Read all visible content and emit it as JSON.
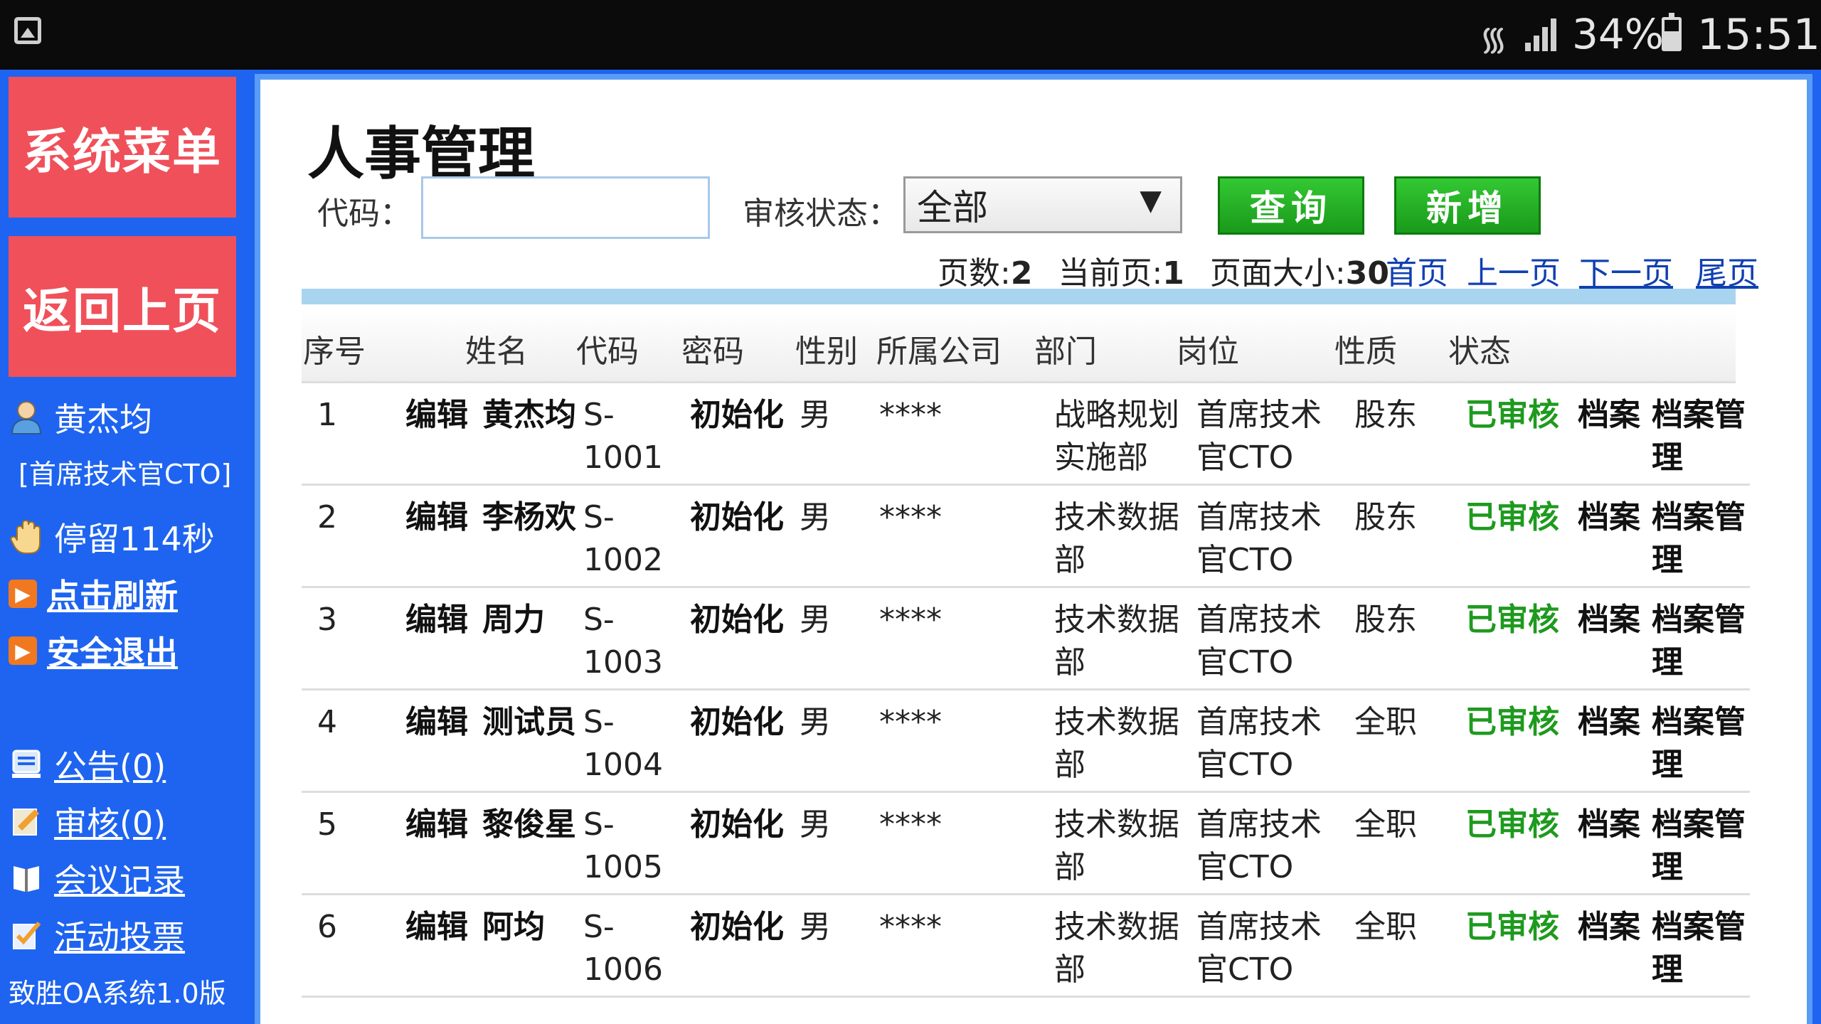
{
  "status_bar": {
    "battery": "34%",
    "time": "15:51"
  },
  "sidebar": {
    "menu_button": "系统菜单",
    "back_button": "返回上页",
    "user_name": "黄杰均",
    "user_role": "[首席技术官CTO]",
    "stay_time": "停留114秒",
    "refresh": "点击刷新",
    "logout": "安全退出",
    "notice": "公告(0)",
    "audit": "审核(0)",
    "meeting": "会议记录",
    "vote": "活动投票",
    "footer": "致胜OA系统1.0版"
  },
  "main": {
    "title": "人事管理",
    "code_label": "代码：",
    "code_value": "",
    "status_label": "审核状态：",
    "status_selected": "全部",
    "query_button": "查询",
    "add_button": "新增",
    "pager": {
      "pages_label": "页数:",
      "pages": "2",
      "current_label": "当前页:",
      "current": "1",
      "size_label": "页面大小:",
      "size": "30",
      "first": "首页",
      "prev": "上一页",
      "next": "下一页",
      "last": "尾页"
    },
    "columns": [
      "序号",
      "姓名",
      "代码",
      "密码",
      "性别",
      "所属公司",
      "部门",
      "岗位",
      "性质",
      "状态"
    ],
    "rows": [
      {
        "no": "1",
        "edit": "编辑",
        "name": "黄杰均",
        "code1": "S-",
        "code2": "1001",
        "pwd": "初始化",
        "gender": "男",
        "company": "****",
        "dept1": "战略规划",
        "dept2": "实施部",
        "post1": "首席技术",
        "post2": "官CTO",
        "nature": "股东",
        "status": "已审核",
        "archive": "档案",
        "archive_mgmt1": "档案管",
        "archive_mgmt2": "理"
      },
      {
        "no": "2",
        "edit": "编辑",
        "name": "李杨欢",
        "code1": "S-",
        "code2": "1002",
        "pwd": "初始化",
        "gender": "男",
        "company": "****",
        "dept1": "技术数据",
        "dept2": "部",
        "post1": "首席技术",
        "post2": "官CTO",
        "nature": "股东",
        "status": "已审核",
        "archive": "档案",
        "archive_mgmt1": "档案管",
        "archive_mgmt2": "理"
      },
      {
        "no": "3",
        "edit": "编辑",
        "name": "周力",
        "code1": "S-",
        "code2": "1003",
        "pwd": "初始化",
        "gender": "男",
        "company": "****",
        "dept1": "技术数据",
        "dept2": "部",
        "post1": "首席技术",
        "post2": "官CTO",
        "nature": "股东",
        "status": "已审核",
        "archive": "档案",
        "archive_mgmt1": "档案管",
        "archive_mgmt2": "理"
      },
      {
        "no": "4",
        "edit": "编辑",
        "name": "测试员",
        "code1": "S-",
        "code2": "1004",
        "pwd": "初始化",
        "gender": "男",
        "company": "****",
        "dept1": "技术数据",
        "dept2": "部",
        "post1": "首席技术",
        "post2": "官CTO",
        "nature": "全职",
        "status": "已审核",
        "archive": "档案",
        "archive_mgmt1": "档案管",
        "archive_mgmt2": "理"
      },
      {
        "no": "5",
        "edit": "编辑",
        "name": "黎俊星",
        "code1": "S-",
        "code2": "1005",
        "pwd": "初始化",
        "gender": "男",
        "company": "****",
        "dept1": "技术数据",
        "dept2": "部",
        "post1": "首席技术",
        "post2": "官CTO",
        "nature": "全职",
        "status": "已审核",
        "archive": "档案",
        "archive_mgmt1": "档案管",
        "archive_mgmt2": "理"
      },
      {
        "no": "6",
        "edit": "编辑",
        "name": "阿均",
        "code1": "S-",
        "code2": "1006",
        "pwd": "初始化",
        "gender": "男",
        "company": "****",
        "dept1": "技术数据",
        "dept2": "部",
        "post1": "首席技术",
        "post2": "官CTO",
        "nature": "全职",
        "status": "已审核",
        "archive": "档案",
        "archive_mgmt1": "档案管",
        "archive_mgmt2": "理"
      }
    ]
  },
  "colors": {
    "sidebar_bg": "#1E64F0",
    "sidebar_button": "#F0505A",
    "approved": "#1E9A1E",
    "action_button": "#22AA22"
  }
}
